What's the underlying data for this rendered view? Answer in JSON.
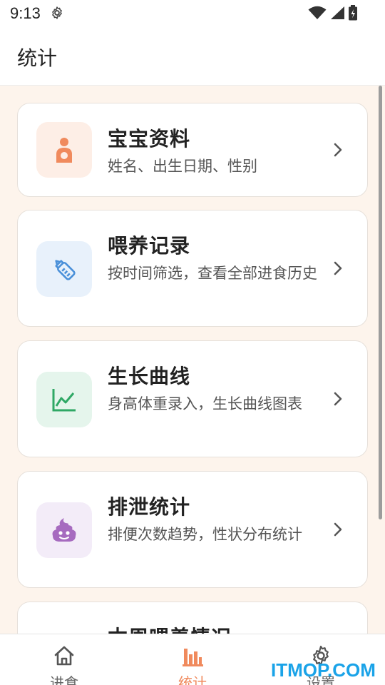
{
  "status_bar": {
    "time": "9:13"
  },
  "app_bar": {
    "title": "统计"
  },
  "cards": [
    {
      "title": "宝宝资料",
      "desc": "姓名、出生日期、性别",
      "icon": "baby-icon",
      "icon_bg": "#fdeee6",
      "icon_color": "#f08a5d"
    },
    {
      "title": "喂养记录",
      "desc": "按时间筛选，查看全部进食历史",
      "icon": "bottle-icon",
      "icon_bg": "#e8f1fb",
      "icon_color": "#4a90d9"
    },
    {
      "title": "生长曲线",
      "desc": "身高体重录入，生长曲线图表",
      "icon": "growth-chart-icon",
      "icon_bg": "#e5f5ec",
      "icon_color": "#2fa865"
    },
    {
      "title": "排泄统计",
      "desc": "排便次数趋势，性状分布统计",
      "icon": "poop-icon",
      "icon_bg": "#f3ecf8",
      "icon_color": "#a66bbf"
    },
    {
      "title": "本周喂养情况",
      "desc": "",
      "icon": "",
      "icon_bg": "",
      "icon_color": ""
    }
  ],
  "bottom_nav": [
    {
      "label": "进食",
      "icon": "home-icon",
      "active": false
    },
    {
      "label": "统计",
      "icon": "bar-chart-icon",
      "active": true
    },
    {
      "label": "设置",
      "icon": "gear-icon",
      "active": false
    }
  ],
  "watermark": "ITMOP.COM",
  "colors": {
    "accent": "#f08a5d",
    "background": "#fdf4ec"
  }
}
